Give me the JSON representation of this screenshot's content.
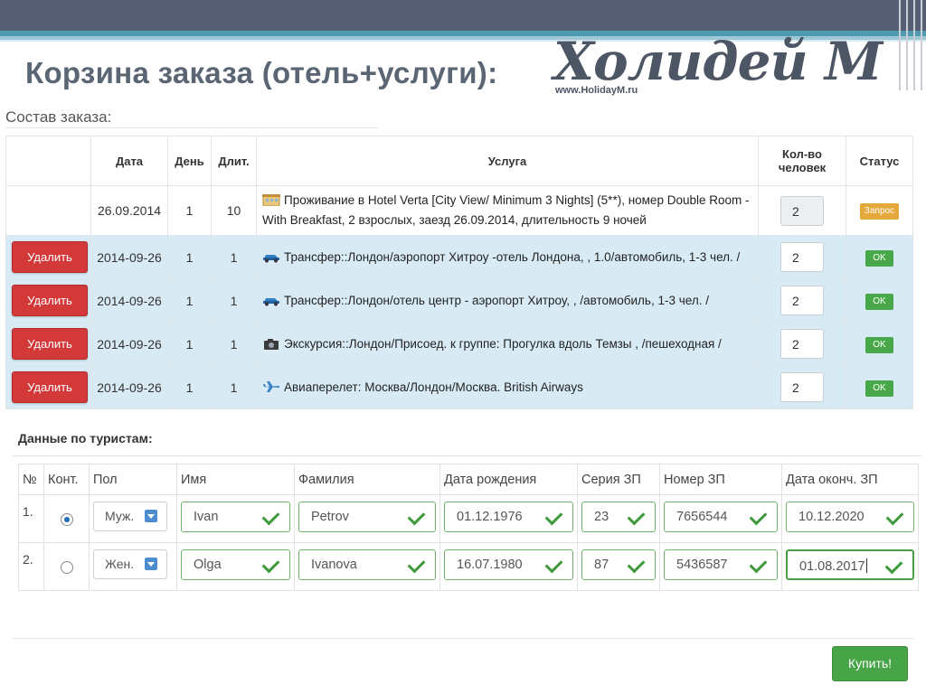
{
  "slide_title": "Корзина заказа (отель+услуги):",
  "logo": {
    "name": "Холидей М",
    "url": "www.HolidayM.ru"
  },
  "order": {
    "section_label": "Состав заказа:",
    "columns": {
      "date": "Дата",
      "day": "День",
      "duration": "Длит.",
      "service": "Услуга",
      "qty_line1": "Кол-во",
      "qty_line2": "человек",
      "status": "Статус"
    },
    "rows": [
      {
        "action": "",
        "date": "26.09.2014",
        "day": "1",
        "duration": "10",
        "icon": "hotel-icon",
        "service": "Проживание в Hotel Verta [City View/ Minimum 3 Nights] (5**), номер Double Room - With Breakfast, 2 взрослых, заезд 26.09.2014, длительность 9 ночей",
        "qty": "2",
        "status": "Запрос"
      },
      {
        "action": "Удалить",
        "date": "2014-09-26",
        "day": "1",
        "duration": "1",
        "icon": "car-icon",
        "service": "Трансфер::Лондон/аэропорт Хитроу -отель Лондона, , 1.0/автомобиль, 1-3 чел. /",
        "qty": "2",
        "status": "OK"
      },
      {
        "action": "Удалить",
        "date": "2014-09-26",
        "day": "1",
        "duration": "1",
        "icon": "car-icon",
        "service": "Трансфер::Лондон/отель центр - аэропорт Хитроу, , /автомобиль, 1-3 чел. /",
        "qty": "2",
        "status": "OK"
      },
      {
        "action": "Удалить",
        "date": "2014-09-26",
        "day": "1",
        "duration": "1",
        "icon": "camera-icon",
        "service": "Экскурсия::Лондон/Присоед. к группе: Прогулка вдоль Темзы , /пешеходная /",
        "qty": "2",
        "status": "OK"
      },
      {
        "action": "Удалить",
        "date": "2014-09-26",
        "day": "1",
        "duration": "1",
        "icon": "plane-icon",
        "service": "Авиаперелет: Москва/Лондон/Москва. British Airways",
        "qty": "2",
        "status": "OK"
      }
    ]
  },
  "tourists": {
    "section_label": "Данные по туристам:",
    "columns": {
      "num": "№",
      "contact": "Конт.",
      "gender": "Пол",
      "first_name": "Имя",
      "last_name": "Фамилия",
      "birth_date": "Дата рождения",
      "passport_series": "Серия ЗП",
      "passport_number": "Номер ЗП",
      "passport_expiry": "Дата оконч. ЗП"
    },
    "rows": [
      {
        "num": "1.",
        "contact": true,
        "gender": "Муж.",
        "first_name": "Ivan",
        "last_name": "Petrov",
        "birth_date": "01.12.1976",
        "passport_series": "23",
        "passport_number": "7656544",
        "passport_expiry": "10.12.2020"
      },
      {
        "num": "2.",
        "contact": false,
        "gender": "Жен.",
        "first_name": "Olga",
        "last_name": "Ivanova",
        "birth_date": "16.07.1980",
        "passport_series": "87",
        "passport_number": "5436587",
        "passport_expiry": "01.08.2017"
      }
    ]
  },
  "buy_button": "Купить!",
  "colors": {
    "delete": "#d4393a",
    "ok": "#48a84a",
    "request": "#e5a83b",
    "row_highlight": "#d8ebf4",
    "buy": "#47a447"
  }
}
